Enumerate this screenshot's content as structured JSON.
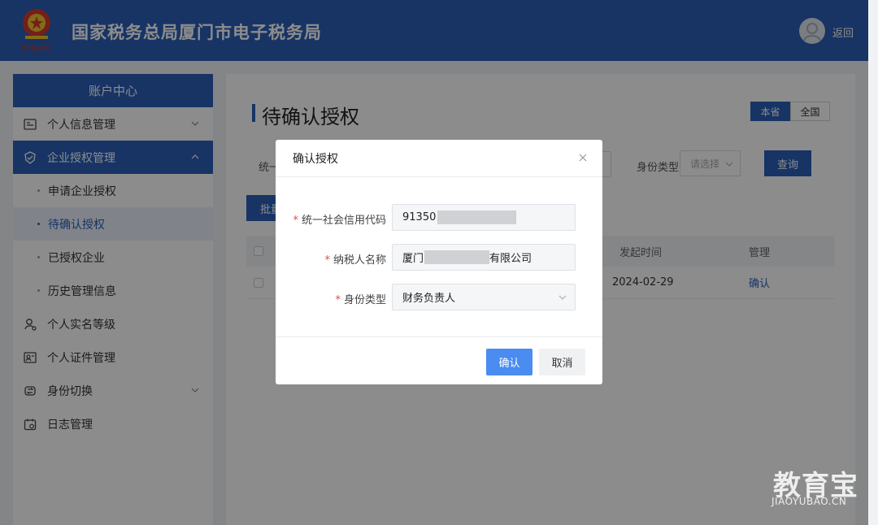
{
  "header": {
    "title": "国家税务总局厦门市电子税务局",
    "back_label": "返回",
    "colors": {
      "primary": "#2b5fb8"
    }
  },
  "sidebar": {
    "title": "账户中心",
    "items": [
      {
        "label": "个人信息管理",
        "icon": "id-card-icon",
        "expandable": true
      },
      {
        "label": "企业授权管理",
        "icon": "shield-check-icon",
        "expandable": true,
        "expanded": true
      },
      {
        "label": "申请企业授权"
      },
      {
        "label": "待确认授权",
        "selected": true
      },
      {
        "label": "已授权企业"
      },
      {
        "label": "历史管理信息"
      },
      {
        "label": "个人实名等级",
        "icon": "user-level-icon"
      },
      {
        "label": "个人证件管理",
        "icon": "certificate-icon"
      },
      {
        "label": "身份切换",
        "icon": "switch-icon",
        "expandable": true
      },
      {
        "label": "日志管理",
        "icon": "calendar-log-icon"
      }
    ]
  },
  "main": {
    "page_title": "待确认授权",
    "scope": {
      "options": [
        "本省",
        "全国"
      ],
      "selected": "本省"
    },
    "filters": {
      "credit_code_label_partial": "统一",
      "identity_type_label": "身份类型",
      "identity_type_placeholder": "请选择",
      "query_label": "查询"
    },
    "batch_label_partial": "批量",
    "table": {
      "headers": {
        "time": "发起时间",
        "action": "管理"
      },
      "rows": [
        {
          "time": "2024-02-29",
          "action": "确认"
        }
      ]
    }
  },
  "modal": {
    "title": "确认授权",
    "fields": [
      {
        "label": "统一社会信用代码",
        "value_prefix": "91350",
        "value_suffix": ""
      },
      {
        "label": "纳税人名称",
        "value_prefix": "厦门",
        "value_suffix": "有限公司"
      },
      {
        "label": "身份类型",
        "value_prefix": "财务负责人",
        "value_suffix": ""
      }
    ],
    "confirm_label": "确认",
    "cancel_label": "取消"
  },
  "watermark": {
    "logo": "教育宝",
    "url": "JIAOYUBAO.CN"
  }
}
